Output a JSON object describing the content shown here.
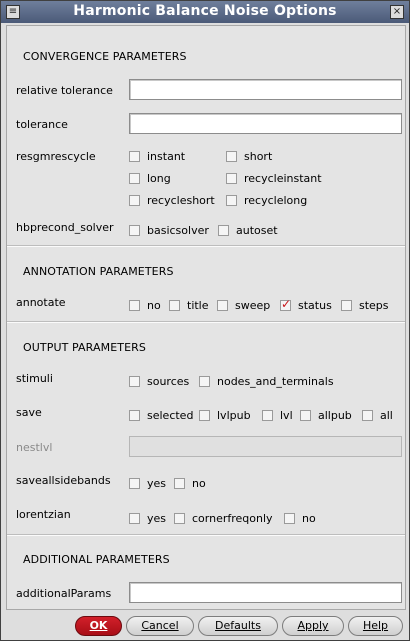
{
  "window": {
    "title": "Harmonic Balance Noise Options",
    "menu_glyph": "≡",
    "close_glyph": "×"
  },
  "sections": {
    "convergence": "CONVERGENCE PARAMETERS",
    "annotation": "ANNOTATION PARAMETERS",
    "output": "OUTPUT PARAMETERS",
    "additional": "ADDITIONAL PARAMETERS"
  },
  "fields": {
    "reltol": {
      "label": "relative tolerance",
      "value": ""
    },
    "tolerance": {
      "label": "tolerance",
      "value": ""
    },
    "resgmrescycle": {
      "label": "resgmrescycle",
      "options": [
        {
          "label": "instant",
          "checked": false
        },
        {
          "label": "short",
          "checked": false
        },
        {
          "label": "long",
          "checked": false
        },
        {
          "label": "recycleinstant",
          "checked": false
        },
        {
          "label": "recycleshort",
          "checked": false
        },
        {
          "label": "recyclelong",
          "checked": false
        }
      ]
    },
    "hbprecond_solver": {
      "label": "hbprecond_solver",
      "options": [
        {
          "label": "basicsolver",
          "checked": false
        },
        {
          "label": "autoset",
          "checked": false
        }
      ]
    },
    "annotate": {
      "label": "annotate",
      "options": [
        {
          "label": "no",
          "checked": false
        },
        {
          "label": "title",
          "checked": false
        },
        {
          "label": "sweep",
          "checked": false
        },
        {
          "label": "status",
          "checked": true
        },
        {
          "label": "steps",
          "checked": false
        }
      ]
    },
    "stimuli": {
      "label": "stimuli",
      "options": [
        {
          "label": "sources",
          "checked": false
        },
        {
          "label": "nodes_and_terminals",
          "checked": false
        }
      ]
    },
    "save": {
      "label": "save",
      "options": [
        {
          "label": "selected",
          "checked": false
        },
        {
          "label": "lvlpub",
          "checked": false
        },
        {
          "label": "lvl",
          "checked": false
        },
        {
          "label": "allpub",
          "checked": false
        },
        {
          "label": "all",
          "checked": false
        }
      ]
    },
    "nestlvl": {
      "label": "nestlvl",
      "value": ""
    },
    "saveallsidebands": {
      "label": "saveallsidebands",
      "options": [
        {
          "label": "yes",
          "checked": false
        },
        {
          "label": "no",
          "checked": false
        }
      ]
    },
    "lorentzian": {
      "label": "lorentzian",
      "options": [
        {
          "label": "yes",
          "checked": false
        },
        {
          "label": "cornerfreqonly",
          "checked": false
        },
        {
          "label": "no",
          "checked": false
        }
      ]
    },
    "additionalParams": {
      "label": "additionalParams",
      "value": ""
    }
  },
  "buttons": {
    "ok": "OK",
    "cancel": "Cancel",
    "defaults": "Defaults",
    "apply": "Apply",
    "help": "Help"
  }
}
